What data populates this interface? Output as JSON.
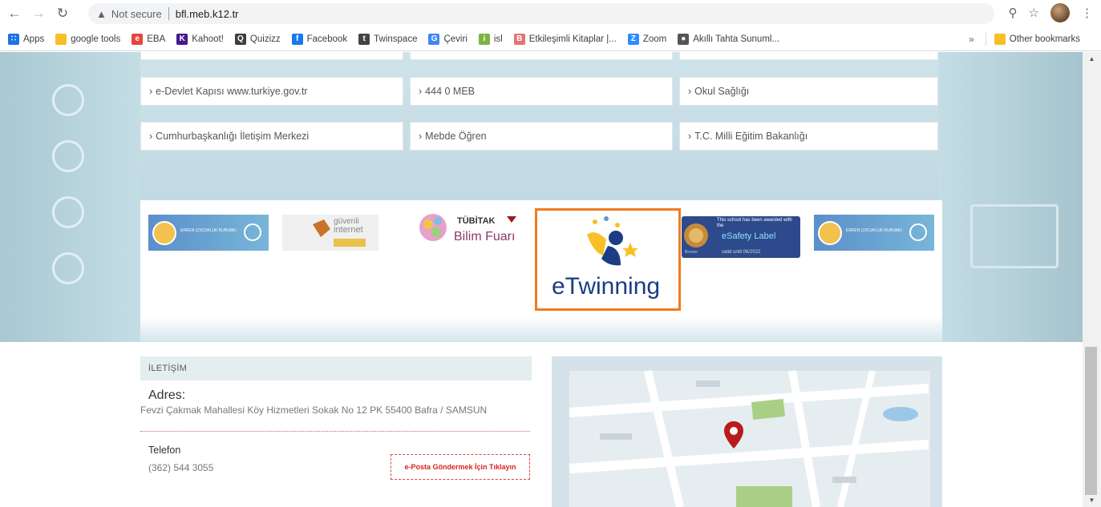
{
  "browser": {
    "security_label": "Not secure",
    "url": "bfl.meb.k12.tr"
  },
  "bookmarks": [
    {
      "label": "Apps",
      "icon": "apps-grid-icon",
      "color": "#1a73e8"
    },
    {
      "label": "google tools",
      "icon": "folder-icon",
      "color": "#f6c026"
    },
    {
      "label": "EBA",
      "icon": "eba-icon",
      "color": "#e8453c"
    },
    {
      "label": "Kahoot!",
      "icon": "kahoot-icon",
      "color": "#46178f"
    },
    {
      "label": "Quizizz",
      "icon": "quizizz-icon",
      "color": "#3d3d3d"
    },
    {
      "label": "Facebook",
      "icon": "facebook-icon",
      "color": "#1877f2"
    },
    {
      "label": "Twinspace",
      "icon": "twinspace-icon",
      "color": "#444444"
    },
    {
      "label": "Çeviri",
      "icon": "translate-icon",
      "color": "#4285f4"
    },
    {
      "label": "isl",
      "icon": "isl-icon",
      "color": "#7cb342"
    },
    {
      "label": "Etkileşimli Kitaplar |...",
      "icon": "book-icon",
      "color": "#e57373"
    },
    {
      "label": "Zoom",
      "icon": "zoom-icon",
      "color": "#2d8cff"
    },
    {
      "label": "Akıllı Tahta Sunuml...",
      "icon": "globe-icon",
      "color": "#555555"
    }
  ],
  "bookmarks_overflow": "»",
  "other_bookmarks": "Other bookmarks",
  "links": {
    "row1": [
      "e-Devlet Kapısı www.turkiye.gov.tr",
      "444 0 MEB",
      "Okul Sağlığı"
    ],
    "row2": [
      "Cumhurbaşkanlığı İletişim Merkezi",
      "Mebde Öğren",
      "T.C. Milli Eğitim Bakanlığı"
    ]
  },
  "logos": {
    "gdk_small": "ERKEN ÇOCUKLUK KURUMU",
    "guvenli_top": "güvenli",
    "guvenli_bottom": "internet",
    "tubitak_top": "TÜBİTAK",
    "tubitak_bottom": "Bilim Fuarı",
    "etwinning": "eTwinning",
    "esafety_top": "This school has been awarded with the",
    "esafety_title": "eSafety Label",
    "esafety_level": "Bronze",
    "esafety_valid": "valid until 06/2022"
  },
  "contact": {
    "header": "İLETİŞİM",
    "address_label": "Adres:",
    "address_value": "Fevzi Çakmak Mahallesi Köy Hizmetleri Sokak No 12 PK 55400 Bafra / SAMSUN",
    "phone_label": "Telefon",
    "phone_value": "(362) 544 3055",
    "email_button": "e-Posta Göndermek İçin Tıklayın"
  },
  "colors": {
    "etwinning_frame": "#f07b1e",
    "map_pin": "#b71c1c"
  }
}
